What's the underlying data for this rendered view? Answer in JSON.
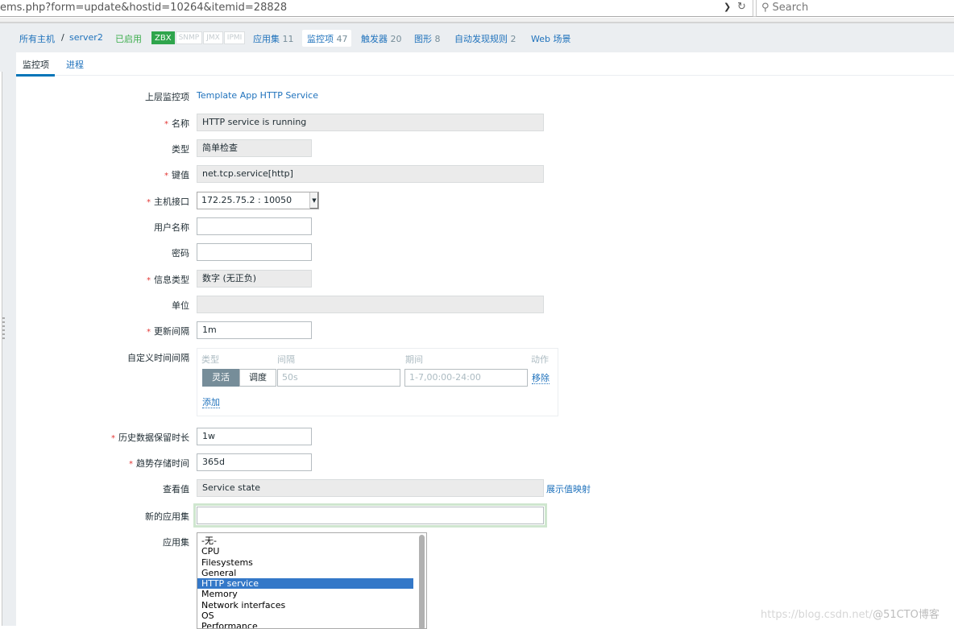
{
  "browser": {
    "url": "ems.php?form=update&hostid=10264&itemid=28828",
    "search_placeholder": "Search"
  },
  "hostnav": {
    "all_hosts": "所有主机",
    "separator": "/",
    "host": "server2",
    "status": "已启用",
    "badges": [
      "ZBX",
      "SNMP",
      "JMX",
      "IPMI"
    ],
    "tabs": [
      {
        "label": "应用集",
        "count": "11"
      },
      {
        "label": "监控项",
        "count": "47",
        "active": true
      },
      {
        "label": "触发器",
        "count": "20"
      },
      {
        "label": "图形",
        "count": "8"
      },
      {
        "label": "自动发现规则",
        "count": "2"
      },
      {
        "label": "Web 场景",
        "count": ""
      }
    ]
  },
  "subtabs": [
    "监控项",
    "进程"
  ],
  "form": {
    "parent": {
      "label": "上层监控项",
      "value": "Template App HTTP Service"
    },
    "name": {
      "label": "名称",
      "value": "HTTP service is running"
    },
    "type": {
      "label": "类型",
      "value": "简单检查"
    },
    "key": {
      "label": "键值",
      "value": "net.tcp.service[http]"
    },
    "interface": {
      "label": "主机接口",
      "value": "172.25.75.2 : 10050"
    },
    "username": {
      "label": "用户名称",
      "value": ""
    },
    "password": {
      "label": "密码",
      "value": ""
    },
    "info_type": {
      "label": "信息类型",
      "value": "数字 (无正负)"
    },
    "units": {
      "label": "单位",
      "value": ""
    },
    "update_interval": {
      "label": "更新间隔",
      "value": "1m"
    },
    "custom_intervals": {
      "label": "自定义时间间隔",
      "headers": {
        "type": "类型",
        "interval": "间隔",
        "period": "期间",
        "action": "动作"
      },
      "type_options": [
        "灵活",
        "调度"
      ],
      "interval_placeholder": "50s",
      "period_placeholder": "1-7,00:00-24:00",
      "remove": "移除",
      "add": "添加"
    },
    "history": {
      "label": "历史数据保留时长",
      "value": "1w"
    },
    "trends": {
      "label": "趋势存储时间",
      "value": "365d"
    },
    "valuemap": {
      "label": "查看值",
      "value": "Service state",
      "link": "展示值映射"
    },
    "new_application": {
      "label": "新的应用集",
      "value": ""
    },
    "applications": {
      "label": "应用集",
      "options": [
        "-无-",
        "CPU",
        "Filesystems",
        "General",
        "HTTP service",
        "Memory",
        "Network interfaces",
        "OS",
        "Performance"
      ],
      "selected": "HTTP service"
    }
  },
  "watermark": {
    "text1": "https://blog.csdn.net/",
    "text2": "@51CTO博客"
  }
}
